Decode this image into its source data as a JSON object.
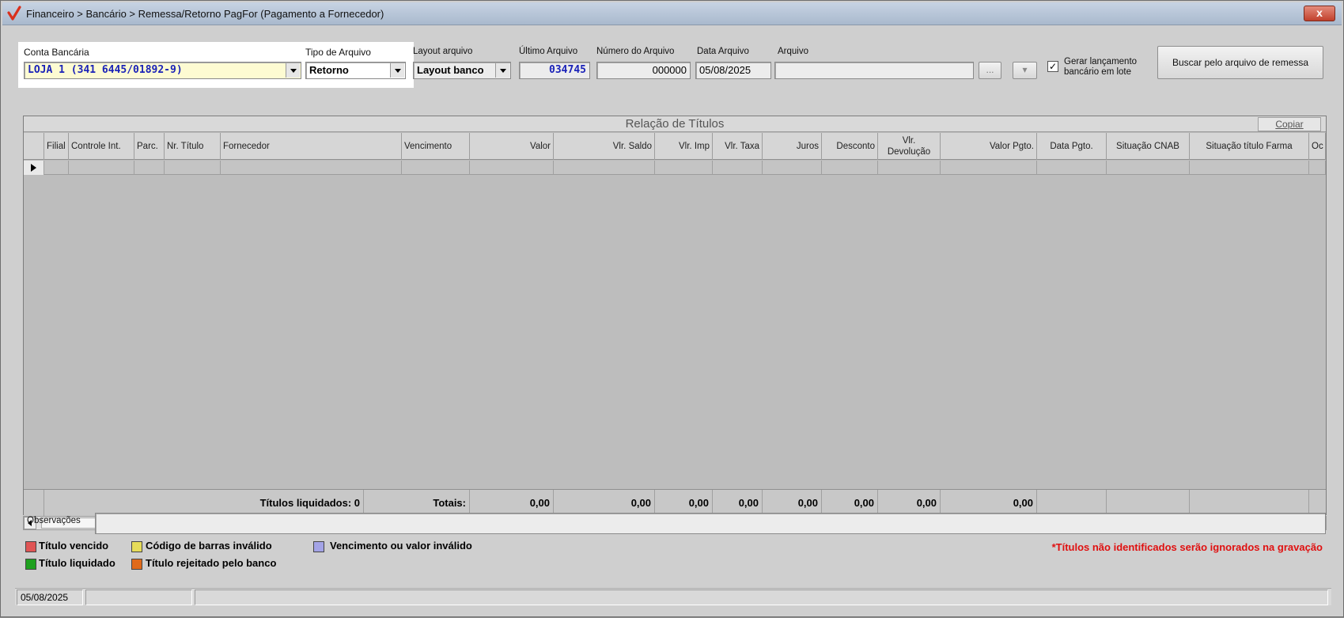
{
  "window": {
    "title": "Financeiro > Bancário > Remessa/Retorno PagFor (Pagamento  a Fornecedor)",
    "close_label": "x"
  },
  "filters": {
    "conta_bancaria_label": "Conta Bancária",
    "conta_bancaria_value": "LOJA 1 (341 6445/01892-9)",
    "tipo_arquivo_label": "Tipo de Arquivo",
    "tipo_arquivo_value": "Retorno",
    "layout_arquivo_label": "Layout arquivo",
    "layout_arquivo_value": "Layout banco",
    "ultimo_arquivo_label": "Último Arquivo",
    "ultimo_arquivo_value": "034745",
    "numero_arquivo_label": "Número do Arquivo",
    "numero_arquivo_value": "000000",
    "data_arquivo_label": "Data Arquivo",
    "data_arquivo_value": "05/08/2025",
    "arquivo_label": "Arquivo",
    "arquivo_value": "",
    "browse_label": "...",
    "dropdown_btn_label": "▾",
    "gerar_lancamento_line1": "Gerar lançamento",
    "gerar_lancamento_line2": "bancário em lote",
    "gerar_lancamento_checked": "✓",
    "buscar_button": "Buscar pelo arquivo de remessa"
  },
  "grid": {
    "caption": "Relação de Títulos",
    "copy_button": "Copiar",
    "columns": [
      {
        "label": "Filial"
      },
      {
        "label": "Controle Int."
      },
      {
        "label": "Parc."
      },
      {
        "label": "Nr. Título"
      },
      {
        "label": "Fornecedor"
      },
      {
        "label": "Vencimento"
      },
      {
        "label": "Valor"
      },
      {
        "label": "Vlr. Saldo"
      },
      {
        "label": "Vlr. Imp"
      },
      {
        "label": "Vlr. Taxa"
      },
      {
        "label": "Juros"
      },
      {
        "label": "Desconto"
      },
      {
        "label": "Vlr. Devolução"
      },
      {
        "label": "Valor Pgto."
      },
      {
        "label": "Data Pgto."
      },
      {
        "label": "Situação CNAB"
      },
      {
        "label": "Situação título Farma"
      },
      {
        "label": "Oc"
      }
    ],
    "totals": {
      "liquidados": "Títulos liquidados: 0",
      "totais_label": "Totais:",
      "valor": "0,00",
      "saldo": "0,00",
      "imp": "0,00",
      "taxa": "0,00",
      "juros": "0,00",
      "desconto": "0,00",
      "devolucao": "0,00",
      "pgto": "0,00"
    }
  },
  "observacoes": {
    "label": "Observações",
    "value": ""
  },
  "legend": {
    "vencido": "Título vencido",
    "barras": "Código de barras inválido",
    "vencimento_valor": "Vencimento ou valor inválido",
    "liquidado": "Título liquidado",
    "rejeitado": "Título rejeitado pelo banco",
    "warning": "*Títulos não identificados serão ignorados na gravação"
  },
  "colors": {
    "vencido": "#e05555",
    "barras": "#e6dc5a",
    "vencimento_valor": "#a3a3e6",
    "liquidado": "#1fa01f",
    "rejeitado": "#e06a1a",
    "warning": "#e01010",
    "accent_blue": "#1a22b8"
  },
  "statusbar": {
    "date": "05/08/2025",
    "cell2": "",
    "cell3": ""
  }
}
